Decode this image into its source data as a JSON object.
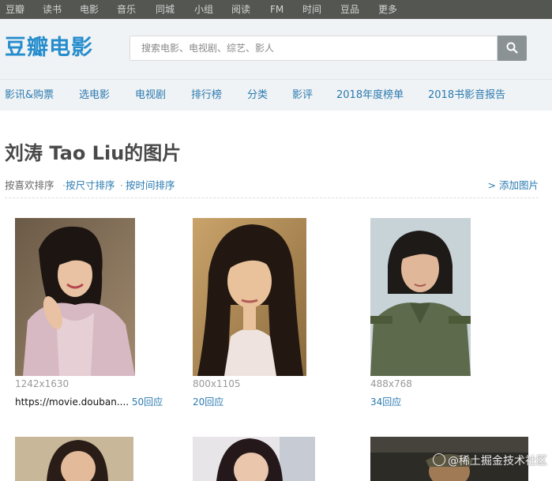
{
  "global_nav": [
    "豆瓣",
    "读书",
    "电影",
    "音乐",
    "同城",
    "小组",
    "阅读",
    "FM",
    "时间",
    "豆品",
    "更多"
  ],
  "header": {
    "logo": "豆瓣电影",
    "search_placeholder": "搜索电影、电视剧、综艺、影人",
    "search_icon": "search-icon"
  },
  "subnav": [
    "影讯&购票",
    "选电影",
    "电视剧",
    "排行榜",
    "分类",
    "影评",
    "2018年度榜单",
    "2018书影音报告"
  ],
  "page": {
    "title": "刘涛 Tao Liu的图片",
    "sort": {
      "current": "按喜欢排序",
      "sep": "·",
      "by_size": "按尺寸排序",
      "by_time": "按时间排序"
    },
    "add_photo": "> 添加图片"
  },
  "photos": [
    {
      "size": "1242x1630",
      "source": "https://movie.douban....",
      "replies": "50回应"
    },
    {
      "size": "800x1105",
      "source": "",
      "replies": "20回应"
    },
    {
      "size": "488x768",
      "source": "",
      "replies": "34回应"
    },
    {
      "size": "",
      "source": "",
      "replies": ""
    },
    {
      "size": "",
      "source": "",
      "replies": ""
    },
    {
      "size": "",
      "source": "",
      "replies": ""
    }
  ],
  "watermark": "@稀土掘金技术社区",
  "colors": {
    "brand": "#268dcd",
    "link": "#2a7ab0",
    "nav_bg": "#545652",
    "header_bg": "#f0f3f5"
  }
}
